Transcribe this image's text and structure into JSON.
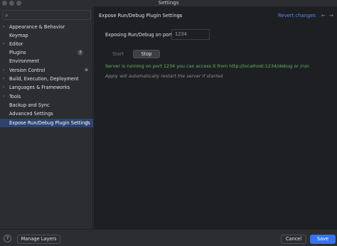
{
  "window": {
    "title": "Settings"
  },
  "sidebar": {
    "search_icon": "search-icon",
    "items": [
      {
        "label": "Appearance & Behavior",
        "expandable": true
      },
      {
        "label": "Keymap",
        "expandable": false
      },
      {
        "label": "Editor",
        "expandable": true
      },
      {
        "label": "Plugins",
        "expandable": false,
        "badge": "3"
      },
      {
        "label": "Environment",
        "expandable": false
      },
      {
        "label": "Version Control",
        "expandable": true
      },
      {
        "label": "Build, Execution, Deployment",
        "expandable": true
      },
      {
        "label": "Languages & Frameworks",
        "expandable": true
      },
      {
        "label": "Tools",
        "expandable": true
      },
      {
        "label": "Backup and Sync",
        "expandable": false
      },
      {
        "label": "Advanced Settings",
        "expandable": false
      },
      {
        "label": "Expose Run/Debug Plugin Settings",
        "expandable": false,
        "selected": true
      }
    ]
  },
  "content": {
    "title": "Expose Run/Debug Plugin Settings",
    "revert_label": "Revert changes",
    "port_label": "Exposing Run/Debug on port:",
    "port_value": "1234",
    "start_label": "Start",
    "stop_label": "Stop",
    "status_text": "Server is running on port 1234 you can access it from http://localhost:1234/debug or /run",
    "hint_text": "Apply will automatically restart the server if started"
  },
  "footer": {
    "help_label": "?",
    "manage_layers_label": "Manage Layers",
    "cancel_label": "Cancel",
    "save_label": "Save"
  },
  "colors": {
    "accent": "#3574f0",
    "link": "#548af7",
    "selection": "#2e436e",
    "status_ok": "#5fb865"
  }
}
